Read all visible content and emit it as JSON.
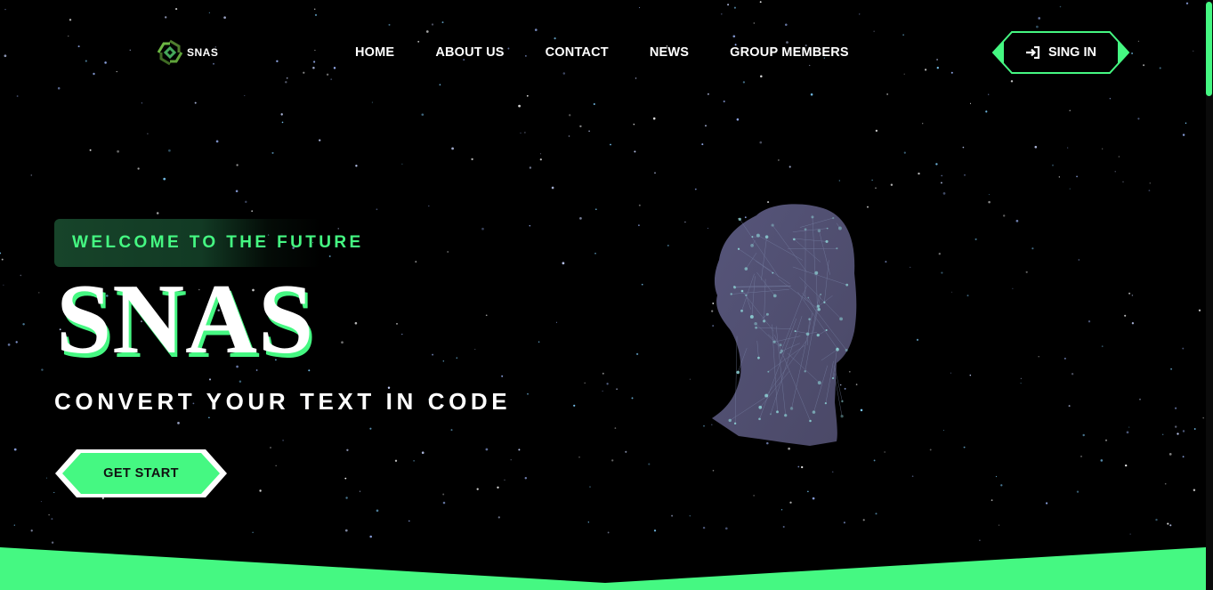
{
  "brand": {
    "name": "SNAS",
    "accent_color": "#45f882"
  },
  "nav": {
    "items": [
      "HOME",
      "ABOUT US",
      "CONTACT",
      "NEWS",
      "GROUP MEMBERS"
    ]
  },
  "signin": {
    "label": "SING IN",
    "icon": "sign-in-icon"
  },
  "hero": {
    "tagline": "WELCOME TO THE FUTURE",
    "title": "SNAS",
    "subtitle": "CONVERT YOUR TEXT IN CODE",
    "cta_label": "GET START"
  },
  "illustration": {
    "icon": "wireframe-head-icon"
  }
}
